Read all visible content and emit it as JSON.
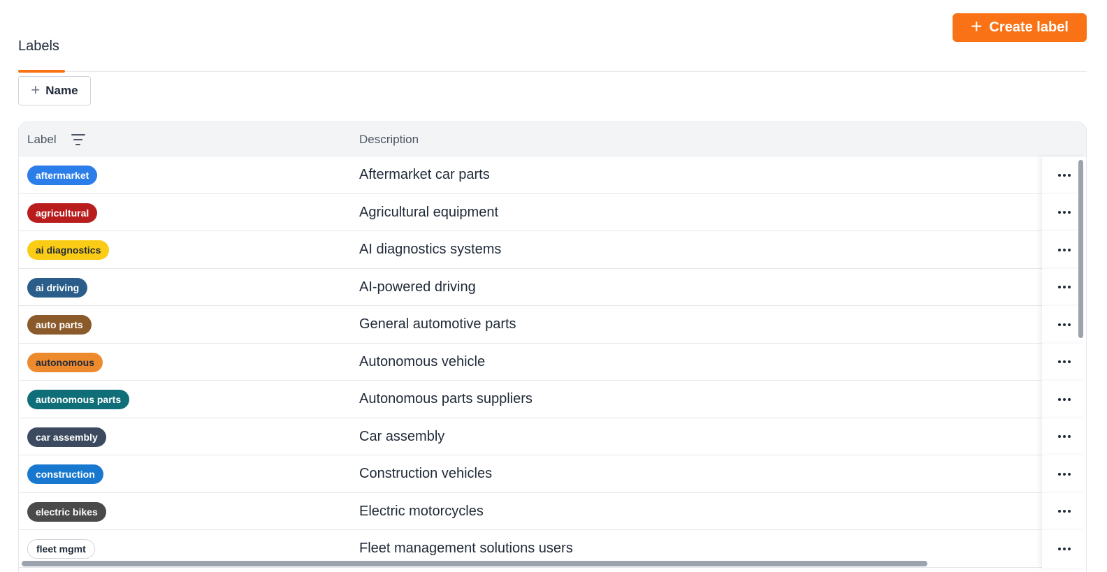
{
  "toolbar": {
    "create_label": "Create label"
  },
  "tabs": [
    {
      "label": "Labels",
      "active": true
    }
  ],
  "filter_button": {
    "label": "Name"
  },
  "table": {
    "columns": {
      "label": "Label",
      "description": "Description"
    },
    "rows": [
      {
        "label": "aftermarket",
        "description": "Aftermarket car parts",
        "bg": "#2b7de9",
        "fg": "#ffffff"
      },
      {
        "label": "agricultural",
        "description": "Agricultural equipment",
        "bg": "#b91c1c",
        "fg": "#ffffff"
      },
      {
        "label": "ai diagnostics",
        "description": "AI diagnostics systems",
        "bg": "#facc15",
        "fg": "#1f2937"
      },
      {
        "label": "ai driving",
        "description": "AI-powered driving",
        "bg": "#2a5d8a",
        "fg": "#ffffff"
      },
      {
        "label": "auto parts",
        "description": "General automotive parts",
        "bg": "#8b5a2b",
        "fg": "#ffffff"
      },
      {
        "label": "autonomous",
        "description": "Autonomous vehicle",
        "bg": "#ee8a2e",
        "fg": "#1f2937"
      },
      {
        "label": "autonomous parts",
        "description": "Autonomous parts suppliers",
        "bg": "#0f6e78",
        "fg": "#ffffff"
      },
      {
        "label": "car assembly",
        "description": "Car assembly",
        "bg": "#3b4a5e",
        "fg": "#ffffff"
      },
      {
        "label": "construction",
        "description": "Construction vehicles",
        "bg": "#1878d0",
        "fg": "#ffffff"
      },
      {
        "label": "electric bikes",
        "description": "Electric motorcycles",
        "bg": "#4a4a4a",
        "fg": "#ffffff"
      },
      {
        "label": "fleet mgmt",
        "description": "Fleet management solutions users",
        "bg": "#ffffff",
        "fg": "#1f2937",
        "border": "#d1d5db"
      }
    ]
  },
  "icons": {
    "plus": "plus-icon",
    "filter": "filter-lines-icon",
    "more": "ellipsis-icon"
  },
  "colors": {
    "accent": "#f97316"
  }
}
